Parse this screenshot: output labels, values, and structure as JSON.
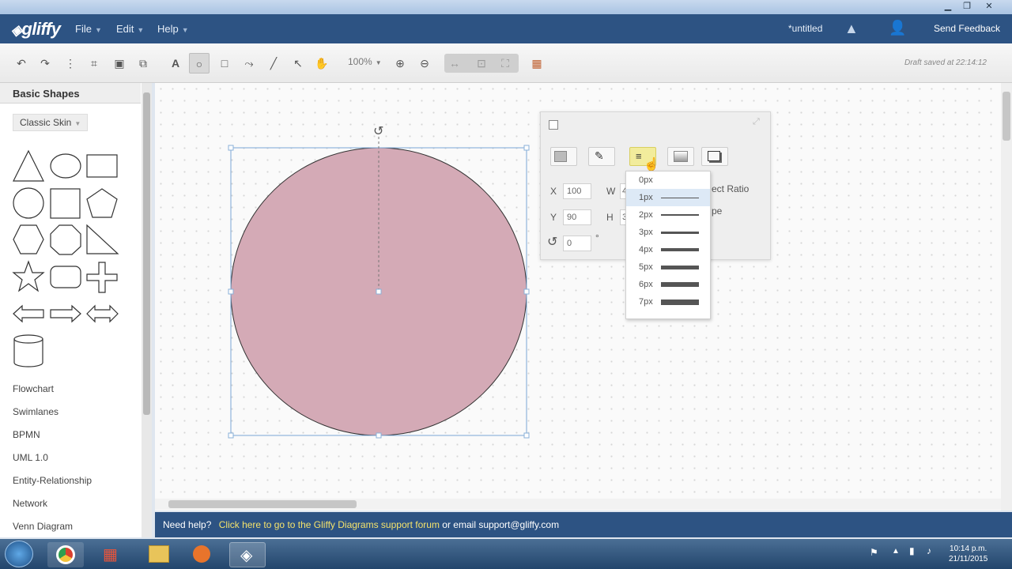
{
  "app": {
    "logo": "gliffy",
    "menu": [
      {
        "label": "File"
      },
      {
        "label": "Edit"
      },
      {
        "label": "Help"
      }
    ],
    "doc_title": "*untitled",
    "feedback": "Send Feedback",
    "accent": "#2d5383"
  },
  "toolbar": {
    "zoom": "100%",
    "draft_saved": "Draft saved at 22:14:12"
  },
  "sidebar": {
    "title": "Basic Shapes",
    "skin": "Classic Skin",
    "categories": [
      {
        "label": "Flowchart"
      },
      {
        "label": "Swimlanes"
      },
      {
        "label": "BPMN"
      },
      {
        "label": "UML 1.0"
      },
      {
        "label": "Entity-Relationship"
      },
      {
        "label": "Network"
      },
      {
        "label": "Venn Diagram"
      }
    ]
  },
  "properties": {
    "x_label": "X",
    "x_value": "100",
    "y_label": "Y",
    "y_value": "90",
    "w_label": "W",
    "w_value": "4",
    "h_label": "H",
    "h_value": "3",
    "rotation_value": "0",
    "aspect_label": "ect Ratio",
    "shape_label": "pe",
    "degree_symbol": "°"
  },
  "line_width_menu": [
    {
      "label": "0px"
    },
    {
      "label": "1px"
    },
    {
      "label": "2px"
    },
    {
      "label": "3px"
    },
    {
      "label": "4px"
    },
    {
      "label": "5px"
    },
    {
      "label": "6px"
    },
    {
      "label": "7px"
    }
  ],
  "shape": {
    "fill": "#d4aab6"
  },
  "helpbar": {
    "prefix": "Need help?",
    "link": "Click here to go to the Gliffy Diagrams support forum",
    "suffix": " or email support@gliffy.com"
  },
  "taskbar": {
    "time": "10:14 p.m.",
    "date": "21/11/2015"
  }
}
